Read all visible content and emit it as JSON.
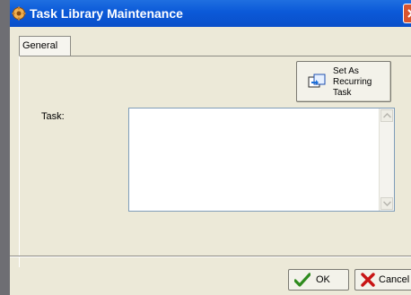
{
  "window": {
    "title": "Task Library Maintenance",
    "app_icon": "app-settings-icon",
    "close_icon": "close-icon"
  },
  "tabs": [
    {
      "label": "General",
      "selected": true
    }
  ],
  "recurring_button": {
    "label": "Set As\nRecurring\nTask",
    "icon": "recurring-task-icon"
  },
  "task_field": {
    "label": "Task:",
    "value": ""
  },
  "footer": {
    "ok_label": "OK",
    "ok_icon": "checkmark-icon",
    "cancel_label": "Cancel",
    "cancel_icon": "x-icon"
  },
  "colors": {
    "titlebar": "#0b59d8",
    "close_button": "#d8552f",
    "window_bg": "#ece9d8"
  }
}
